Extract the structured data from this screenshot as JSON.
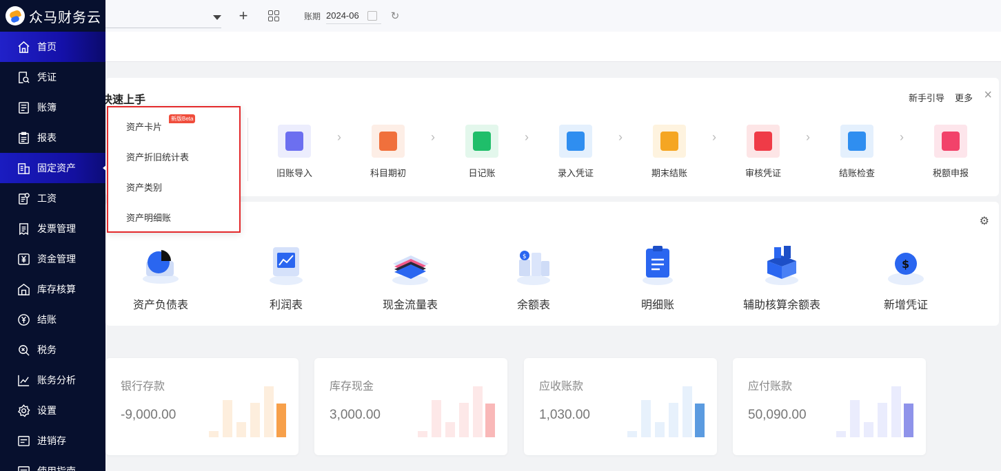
{
  "app": {
    "name": "众马财务云"
  },
  "topbar": {
    "period_label": "账期",
    "period_value": "2024-06"
  },
  "sidebar": {
    "items": [
      {
        "label": "首页",
        "icon": "home-icon"
      },
      {
        "label": "凭证",
        "icon": "voucher-icon"
      },
      {
        "label": "账簿",
        "icon": "ledger-icon"
      },
      {
        "label": "报表",
        "icon": "report-icon"
      },
      {
        "label": "固定资产",
        "icon": "building-icon"
      },
      {
        "label": "工资",
        "icon": "salary-icon"
      },
      {
        "label": "发票管理",
        "icon": "invoice-icon"
      },
      {
        "label": "资金管理",
        "icon": "yen-icon"
      },
      {
        "label": "库存核算",
        "icon": "warehouse-icon"
      },
      {
        "label": "结账",
        "icon": "yen-circle-icon"
      },
      {
        "label": "税务",
        "icon": "tax-icon"
      },
      {
        "label": "账务分析",
        "icon": "chart-icon"
      },
      {
        "label": "设置",
        "icon": "gear-icon"
      },
      {
        "label": "进销存",
        "icon": "inventory-icon"
      },
      {
        "label": "使用指南",
        "icon": "guide-icon"
      }
    ]
  },
  "submenu": {
    "items": [
      "资产卡片",
      "资产折旧统计表",
      "资产类别",
      "资产明细账"
    ],
    "badge": "新版Beta"
  },
  "quick": {
    "title": "快速上手",
    "guide": "新手引导",
    "more": "更多",
    "steps": [
      {
        "label": "旧账导入",
        "color": "#6c6ff0",
        "bg": "#ecedfd"
      },
      {
        "label": "科目期初",
        "color": "#f0703c",
        "bg": "#fdeee6"
      },
      {
        "label": "日记账",
        "color": "#1fbe6a",
        "bg": "#e3f7ec"
      },
      {
        "label": "录入凭证",
        "color": "#2f8ef0",
        "bg": "#e4f0fd"
      },
      {
        "label": "期末结账",
        "color": "#f5a623",
        "bg": "#fef3df"
      },
      {
        "label": "审核凭证",
        "color": "#ef3b47",
        "bg": "#fde5e6"
      },
      {
        "label": "结账检查",
        "color": "#2f8ef0",
        "bg": "#e4f0fd"
      },
      {
        "label": "税额申报",
        "color": "#f2426a",
        "bg": "#fde5eb"
      }
    ]
  },
  "reports": {
    "items": [
      {
        "label": "资产负债表"
      },
      {
        "label": "利润表"
      },
      {
        "label": "现金流量表"
      },
      {
        "label": "余额表"
      },
      {
        "label": "明细账"
      },
      {
        "label": "辅助核算余额表"
      },
      {
        "label": "新增凭证"
      }
    ]
  },
  "kpis": [
    {
      "label": "银行存款",
      "value": "-9,000.00",
      "light": "#fdeedd",
      "dark": "#f7a04a"
    },
    {
      "label": "库存现金",
      "value": "3,000.00",
      "light": "#fde8e8",
      "dark": "#f9b8b8"
    },
    {
      "label": "应收账款",
      "value": "1,030.00",
      "light": "#e7f1fc",
      "dark": "#5b9be0"
    },
    {
      "label": "应付账款",
      "value": "50,090.00",
      "light": "#eaecfd",
      "dark": "#8f93ea"
    }
  ]
}
